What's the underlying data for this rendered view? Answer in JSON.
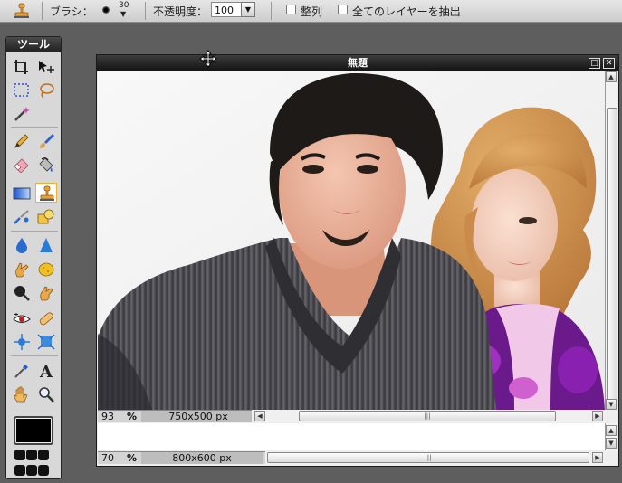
{
  "options_bar": {
    "brush_label": "ブラシ：",
    "brush_size": "30",
    "opacity_label": "不透明度：",
    "opacity_value": "100",
    "align_label": "整列",
    "sample_all_label": "全てのレイヤーを抽出"
  },
  "tools_panel": {
    "title": "ツール",
    "selected_tool": "clone-stamp",
    "foreground_color": "#000000"
  },
  "document_window": {
    "title": "無題",
    "zoom": "93",
    "zoom_unit": "%",
    "dimensions": "750x500 px"
  },
  "secondary_window": {
    "zoom": "70",
    "zoom_unit": "%",
    "dimensions": "800x600 px"
  },
  "icons": {
    "maximize": "□",
    "close": "✕",
    "scroll_up": "▲",
    "scroll_down": "▼",
    "scroll_left": "◀",
    "scroll_right": "▶",
    "grip": "|||"
  }
}
